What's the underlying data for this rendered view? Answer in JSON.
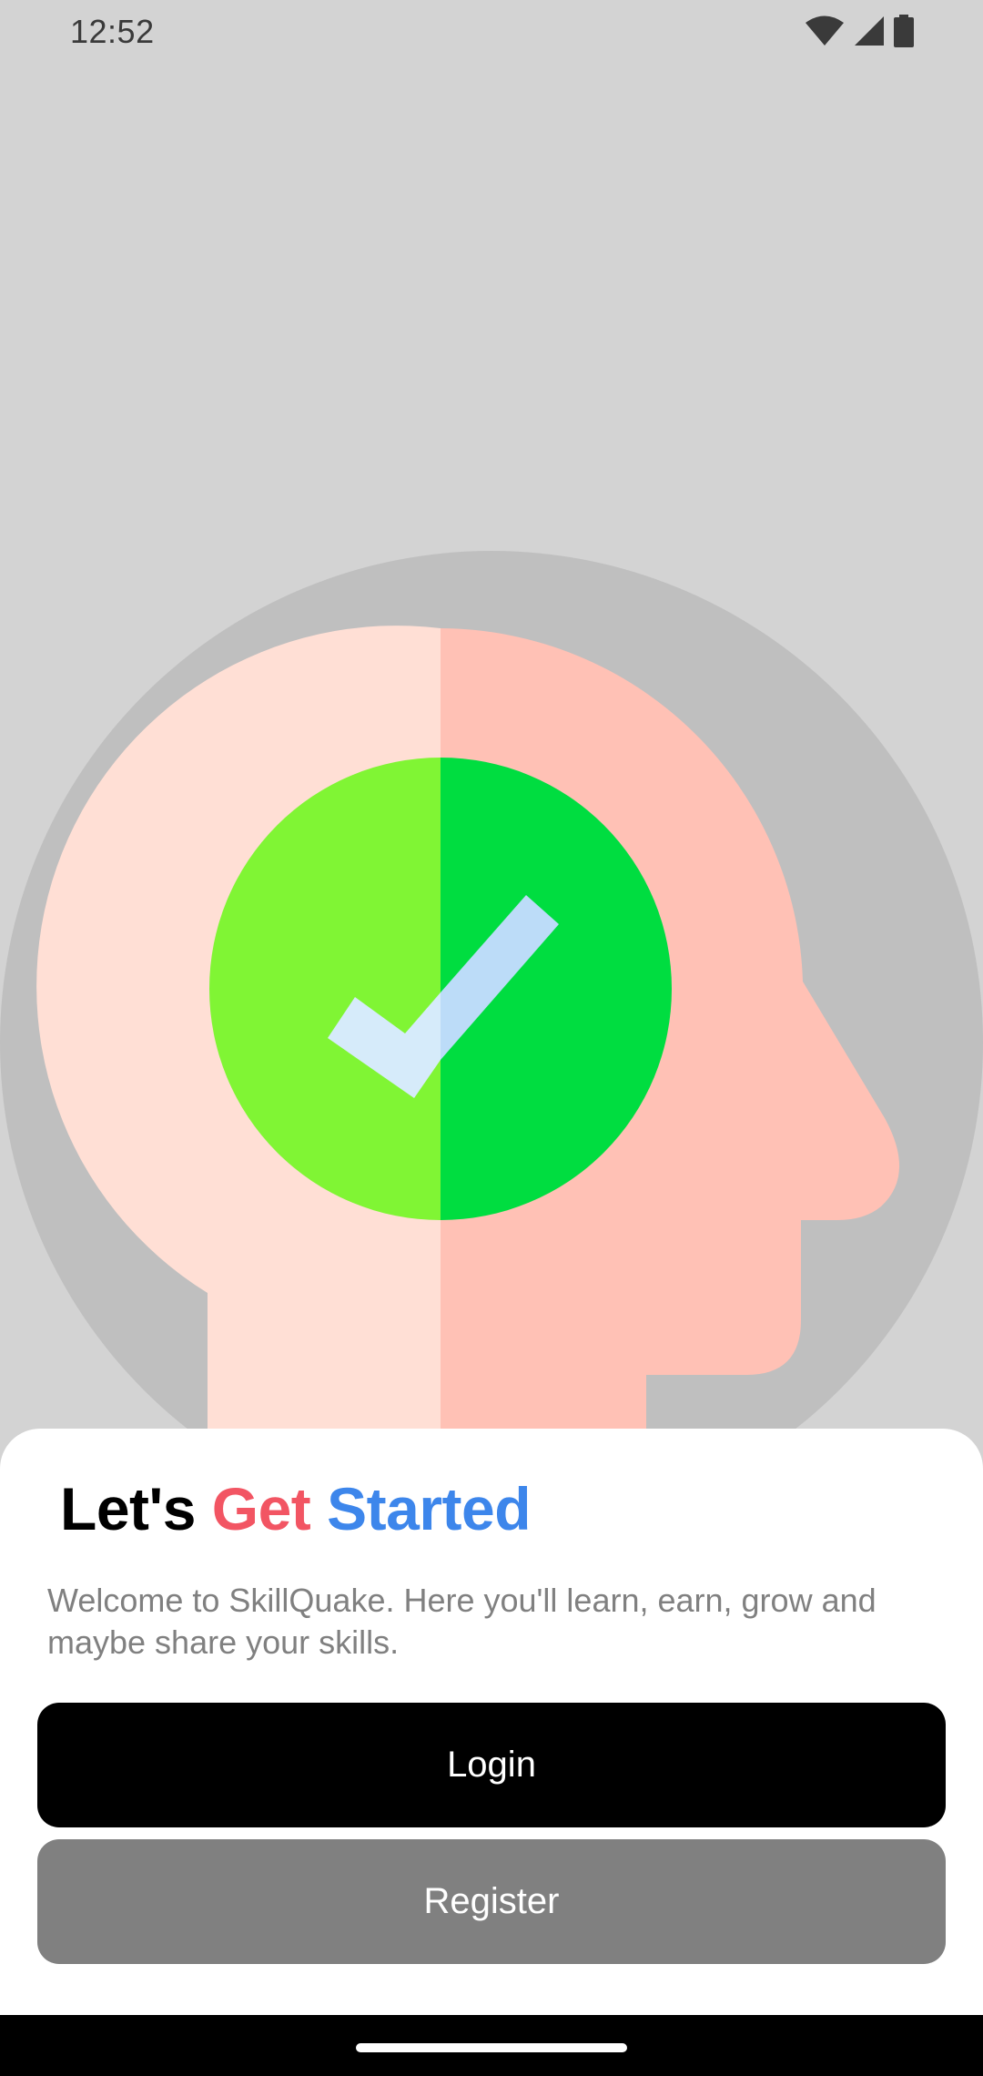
{
  "status_bar": {
    "time": "12:52",
    "icons": [
      "wifi-icon",
      "signal-icon",
      "battery-icon"
    ]
  },
  "illustration": {
    "name": "head-checkmark-illustration",
    "colors": {
      "background_circle": "#bfbfbf",
      "head_left": "#ffdfd5",
      "head_right": "#ffc1b5",
      "circle_left": "#80f534",
      "circle_right": "#00dd40",
      "check_left": "#d6ebfa",
      "check_right": "#bcdcf8"
    }
  },
  "welcome": {
    "title_part1": "Let's",
    "title_part2": "Get",
    "title_part3": "Started",
    "description": "Welcome to SkillQuake. Here you'll learn, earn, grow and maybe share your skills."
  },
  "buttons": {
    "login_label": "Login",
    "register_label": "Register"
  },
  "colors": {
    "screen_background": "#d3d3d3",
    "title_red": "#f25563",
    "title_blue": "#3d86eb",
    "login_bg": "#000000",
    "register_bg": "#808080"
  }
}
